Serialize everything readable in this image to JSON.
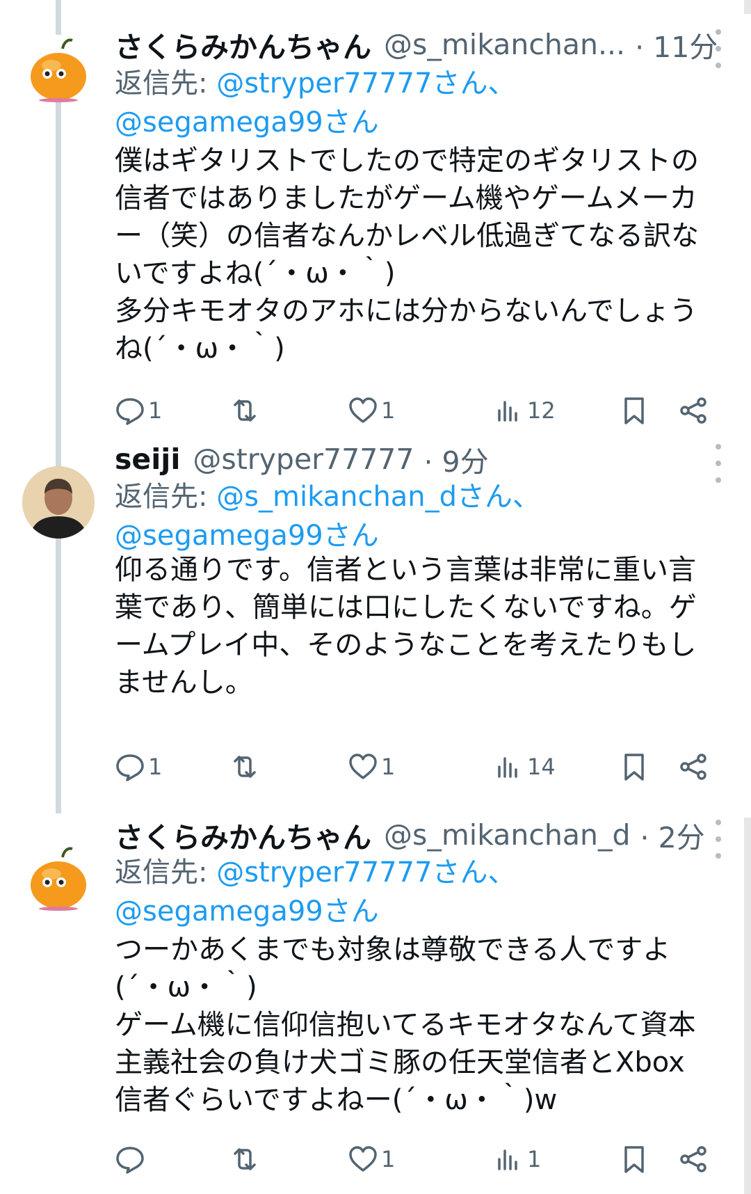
{
  "tweets": [
    {
      "name": "さくらみかんちゃん",
      "handle": "@s_mikanchan...",
      "time": "· 11分",
      "reply_prefix": "返信先: ",
      "reply_mentions": "@stryper77777さん、@segamega99さん",
      "body": "僕はギタリストでしたので特定のギタリストの\n信者ではありましたがゲーム機やゲームメーカ\nー（笑）の信者なんかレベル低過ぎてなる訳な\nいですよね(´・ω・｀)\n多分キモオタのアホには分からないんでしょう\nね(´・ω・｀)",
      "replies": "1",
      "retweets": "",
      "likes": "1",
      "views": "12",
      "avatar_icon": "orange-character-avatar"
    },
    {
      "name": "seiji",
      "handle": "@stryper77777",
      "time": "· 9分",
      "reply_prefix": "返信先: ",
      "reply_mentions": "@s_mikanchan_dさん、@segamega99さん",
      "body": "仰る通りです。信者という言葉は非常に重い言\n葉であり、簡単には口にしたくないですね。ゲ\nームプレイ中、そのようなことを考えたりもし\nませんし。",
      "replies": "1",
      "retweets": "",
      "likes": "1",
      "views": "14",
      "avatar_icon": "person-photo-avatar"
    },
    {
      "name": "さくらみかんちゃん",
      "handle": "@s_mikanchan_d",
      "time": "· 2分",
      "reply_prefix": "返信先: ",
      "reply_mentions": "@stryper77777さん、@segamega99さん",
      "body": "つーかあくまでも対象は尊敬できる人ですよ\n(´・ω・｀)\nゲーム機に信仰信抱いてるキモオタなんて資本\n主義社会の負け犬ゴミ豚の任天堂信者とXbox\n信者ぐらいですよねー(´・ω・｀)w",
      "replies": "",
      "retweets": "",
      "likes": "1",
      "views": "1",
      "avatar_icon": "orange-character-avatar"
    }
  ],
  "colors": {
    "link": "#1d9bf0",
    "muted": "#536471",
    "text": "#0f1419",
    "thread_line": "#cfd9de"
  }
}
